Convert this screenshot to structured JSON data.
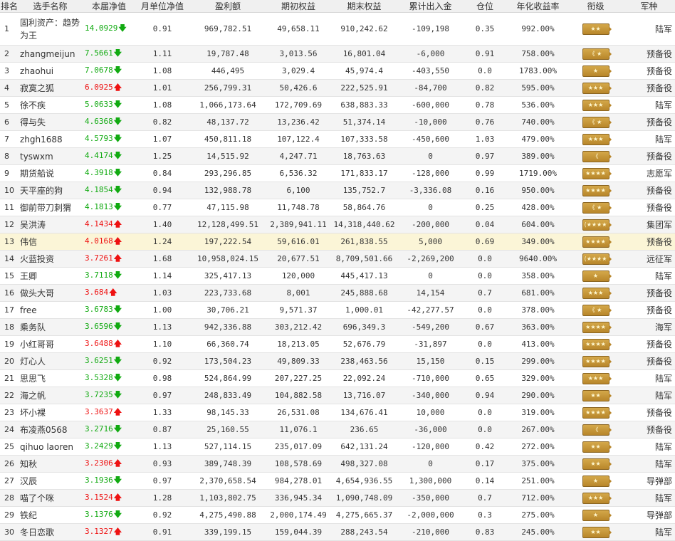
{
  "headers": [
    "排名",
    "选手名称",
    "本届净值",
    "月单位净值",
    "盈利额",
    "期初权益",
    "期末权益",
    "累计出入金",
    "仓位",
    "年化收益率",
    "衔级",
    "军种"
  ],
  "arrows": {
    "up": "🡅",
    "down": "🡇"
  },
  "rows": [
    {
      "rank": "1",
      "name": "固利资产：趋势为王",
      "nav": "14.0929",
      "dir": "down",
      "month": "0.91",
      "profit": "969,782.51",
      "start": "49,658.11",
      "end": "910,242.62",
      "flow": "-109,198",
      "pos": "0.35",
      "annual": "992.00%",
      "badge": "★★",
      "army": "陆军"
    },
    {
      "rank": "2",
      "name": "zhangmeijun",
      "nav": "7.5661",
      "dir": "down",
      "month": "1.11",
      "profit": "19,787.48",
      "start": "3,013.56",
      "end": "16,801.04",
      "flow": "-6,000",
      "pos": "0.91",
      "annual": "758.00%",
      "badge": "《 ★",
      "army": "预备役"
    },
    {
      "rank": "3",
      "name": "zhaohui",
      "nav": "7.0678",
      "dir": "down",
      "month": "1.08",
      "profit": "446,495",
      "start": "3,029.4",
      "end": "45,974.4",
      "flow": "-403,550",
      "pos": "0.0",
      "annual": "1783.00%",
      "badge": "★",
      "army": "预备役"
    },
    {
      "rank": "4",
      "name": "寂寞之狐",
      "nav": "6.0925",
      "dir": "up",
      "month": "1.01",
      "profit": "256,799.31",
      "start": "50,426.6",
      "end": "222,525.91",
      "flow": "-84,700",
      "pos": "0.82",
      "annual": "595.00%",
      "badge": "★★★",
      "army": "预备役"
    },
    {
      "rank": "5",
      "name": "徐不疾",
      "nav": "5.0633",
      "dir": "down",
      "month": "1.08",
      "profit": "1,066,173.64",
      "start": "172,709.69",
      "end": "638,883.33",
      "flow": "-600,000",
      "pos": "0.78",
      "annual": "536.00%",
      "badge": "★★★",
      "army": "陆军"
    },
    {
      "rank": "6",
      "name": "得与失",
      "nav": "4.6368",
      "dir": "down",
      "month": "0.82",
      "profit": "48,137.72",
      "start": "13,236.42",
      "end": "51,374.14",
      "flow": "-10,000",
      "pos": "0.76",
      "annual": "740.00%",
      "badge": "《 ★",
      "army": "预备役"
    },
    {
      "rank": "7",
      "name": "zhgh1688",
      "nav": "4.5793",
      "dir": "down",
      "month": "1.07",
      "profit": "450,811.18",
      "start": "107,122.4",
      "end": "107,333.58",
      "flow": "-450,600",
      "pos": "1.03",
      "annual": "479.00%",
      "badge": "★★★",
      "army": "陆军"
    },
    {
      "rank": "8",
      "name": "tyswxm",
      "nav": "4.4174",
      "dir": "down",
      "month": "1.25",
      "profit": "14,515.92",
      "start": "4,247.71",
      "end": "18,763.63",
      "flow": "0",
      "pos": "0.97",
      "annual": "389.00%",
      "badge": "《",
      "army": "预备役"
    },
    {
      "rank": "9",
      "name": "期货船说",
      "nav": "4.3918",
      "dir": "down",
      "month": "0.84",
      "profit": "293,296.85",
      "start": "6,536.32",
      "end": "171,833.17",
      "flow": "-128,000",
      "pos": "0.99",
      "annual": "1719.00%",
      "badge": "★★★★",
      "army": "志愿军"
    },
    {
      "rank": "10",
      "name": "天平座的狗",
      "nav": "4.1854",
      "dir": "down",
      "month": "0.94",
      "profit": "132,988.78",
      "start": "6,100",
      "end": "135,752.7",
      "flow": "-3,336.08",
      "pos": "0.16",
      "annual": "950.00%",
      "badge": "★★★★",
      "army": "预备役"
    },
    {
      "rank": "11",
      "name": "御前带刀刺猬",
      "nav": "4.1813",
      "dir": "down",
      "month": "0.77",
      "profit": "47,115.98",
      "start": "11,748.78",
      "end": "58,864.76",
      "flow": "0",
      "pos": "0.25",
      "annual": "428.00%",
      "badge": "《 ★",
      "army": "预备役"
    },
    {
      "rank": "12",
      "name": "吴洪涛",
      "nav": "4.1434",
      "dir": "up",
      "month": "1.40",
      "profit": "12,128,499.51",
      "start": "2,389,941.11",
      "end": "14,318,440.62",
      "flow": "-200,000",
      "pos": "0.04",
      "annual": "604.00%",
      "badge": "(★★★★",
      "army": "集团军"
    },
    {
      "rank": "13",
      "name": "伟信",
      "nav": "4.0168",
      "dir": "up",
      "month": "1.24",
      "profit": "197,222.54",
      "start": "59,616.01",
      "end": "261,838.55",
      "flow": "5,000",
      "pos": "0.69",
      "annual": "349.00%",
      "badge": "★★★★",
      "army": "预备役"
    },
    {
      "rank": "14",
      "name": "火蓝投资",
      "nav": "3.7261",
      "dir": "up",
      "month": "1.68",
      "profit": "10,958,024.15",
      "start": "20,677.51",
      "end": "8,709,501.66",
      "flow": "-2,269,200",
      "pos": "0.0",
      "annual": "9640.00%",
      "badge": "(★★★★",
      "army": "远征军"
    },
    {
      "rank": "15",
      "name": "王卿",
      "nav": "3.7118",
      "dir": "down",
      "month": "1.14",
      "profit": "325,417.13",
      "start": "120,000",
      "end": "445,417.13",
      "flow": "0",
      "pos": "0.0",
      "annual": "358.00%",
      "badge": "★",
      "army": "陆军"
    },
    {
      "rank": "16",
      "name": "做头大哥",
      "nav": "3.684",
      "dir": "up",
      "month": "1.03",
      "profit": "223,733.68",
      "start": "8,001",
      "end": "245,888.68",
      "flow": "14,154",
      "pos": "0.7",
      "annual": "681.00%",
      "badge": "★★★",
      "army": "预备役"
    },
    {
      "rank": "17",
      "name": "free",
      "nav": "3.6783",
      "dir": "down",
      "month": "1.00",
      "profit": "30,706.21",
      "start": "9,571.37",
      "end": "1,000.01",
      "flow": "-42,277.57",
      "pos": "0.0",
      "annual": "378.00%",
      "badge": "《 ★",
      "army": "预备役"
    },
    {
      "rank": "18",
      "name": "乘务队",
      "nav": "3.6596",
      "dir": "down",
      "month": "1.13",
      "profit": "942,336.88",
      "start": "303,212.42",
      "end": "696,349.3",
      "flow": "-549,200",
      "pos": "0.67",
      "annual": "363.00%",
      "badge": "★★★★",
      "army": "海军"
    },
    {
      "rank": "19",
      "name": "小红哥哥",
      "nav": "3.6488",
      "dir": "up",
      "month": "1.10",
      "profit": "66,360.74",
      "start": "18,213.05",
      "end": "52,676.79",
      "flow": "-31,897",
      "pos": "0.0",
      "annual": "413.00%",
      "badge": "★★★★",
      "army": "预备役"
    },
    {
      "rank": "20",
      "name": "灯心人",
      "nav": "3.6251",
      "dir": "down",
      "month": "0.92",
      "profit": "173,504.23",
      "start": "49,809.33",
      "end": "238,463.56",
      "flow": "15,150",
      "pos": "0.15",
      "annual": "299.00%",
      "badge": "★★★★",
      "army": "预备役"
    },
    {
      "rank": "21",
      "name": "思思飞",
      "nav": "3.5328",
      "dir": "down",
      "month": "0.98",
      "profit": "524,864.99",
      "start": "207,227.25",
      "end": "22,092.24",
      "flow": "-710,000",
      "pos": "0.65",
      "annual": "329.00%",
      "badge": "★★★",
      "army": "陆军"
    },
    {
      "rank": "22",
      "name": "海之帆",
      "nav": "3.7235",
      "dir": "down",
      "month": "0.97",
      "profit": "248,833.49",
      "start": "104,882.58",
      "end": "13,716.07",
      "flow": "-340,000",
      "pos": "0.94",
      "annual": "290.00%",
      "badge": "★★",
      "army": "陆军"
    },
    {
      "rank": "23",
      "name": "坏小裸",
      "nav": "3.3637",
      "dir": "up",
      "month": "1.33",
      "profit": "98,145.33",
      "start": "26,531.08",
      "end": "134,676.41",
      "flow": "10,000",
      "pos": "0.0",
      "annual": "319.00%",
      "badge": "★★★★",
      "army": "预备役"
    },
    {
      "rank": "24",
      "name": "布凌燕0568",
      "nav": "3.2716",
      "dir": "down",
      "month": "0.87",
      "profit": "25,160.55",
      "start": "11,076.1",
      "end": "236.65",
      "flow": "-36,000",
      "pos": "0.0",
      "annual": "267.00%",
      "badge": "《",
      "army": "预备役"
    },
    {
      "rank": "25",
      "name": "qihuo laoren",
      "nav": "3.2429",
      "dir": "down",
      "month": "1.13",
      "profit": "527,114.15",
      "start": "235,017.09",
      "end": "642,131.24",
      "flow": "-120,000",
      "pos": "0.42",
      "annual": "272.00%",
      "badge": "★★",
      "army": "陆军"
    },
    {
      "rank": "26",
      "name": "知秋",
      "nav": "3.2306",
      "dir": "up",
      "month": "0.93",
      "profit": "389,748.39",
      "start": "108,578.69",
      "end": "498,327.08",
      "flow": "0",
      "pos": "0.17",
      "annual": "375.00%",
      "badge": "★★",
      "army": "陆军"
    },
    {
      "rank": "27",
      "name": "汉辰",
      "nav": "3.1936",
      "dir": "down",
      "month": "0.97",
      "profit": "2,370,658.54",
      "start": "984,278.01",
      "end": "4,654,936.55",
      "flow": "1,300,000",
      "pos": "0.14",
      "annual": "251.00%",
      "badge": "★",
      "army": "导弹部"
    },
    {
      "rank": "28",
      "name": "喵了个咪",
      "nav": "3.1524",
      "dir": "up",
      "month": "1.28",
      "profit": "1,103,802.75",
      "start": "336,945.34",
      "end": "1,090,748.09",
      "flow": "-350,000",
      "pos": "0.7",
      "annual": "712.00%",
      "badge": "★★★",
      "army": "陆军"
    },
    {
      "rank": "29",
      "name": "铁纪",
      "nav": "3.1376",
      "dir": "down",
      "month": "0.92",
      "profit": "4,275,490.88",
      "start": "2,000,174.49",
      "end": "4,275,665.37",
      "flow": "-2,000,000",
      "pos": "0.3",
      "annual": "275.00%",
      "badge": "★",
      "army": "导弹部"
    },
    {
      "rank": "30",
      "name": "冬日恋歌",
      "nav": "3.1327",
      "dir": "up",
      "month": "0.91",
      "profit": "339,199.15",
      "start": "159,044.39",
      "end": "288,243.54",
      "flow": "-210,000",
      "pos": "0.83",
      "annual": "245.00%",
      "badge": "★★",
      "army": "陆军"
    }
  ]
}
